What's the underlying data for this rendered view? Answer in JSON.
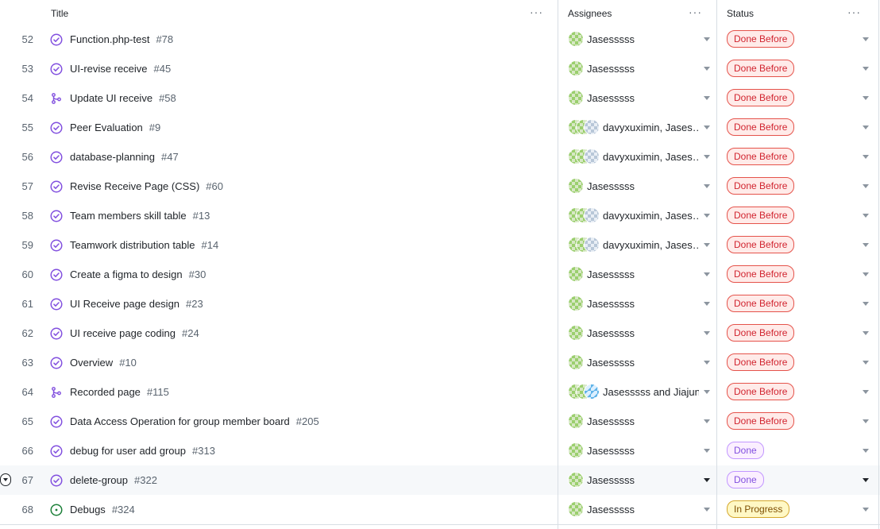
{
  "header": {
    "title": "Title",
    "assignees": "Assignees",
    "status": "Status",
    "menu": "···"
  },
  "colors": {
    "done_before": "#d1242f",
    "done": "#8250df",
    "in_progress": "#7d4e00",
    "closed_issue_icon": "#8250df",
    "open_issue_icon": "#1a7f37"
  },
  "rows": [
    {
      "num": "52",
      "title": "Function.php-test",
      "issue": "#78",
      "icon": "check-circle-icon",
      "avatars": [
        "a"
      ],
      "assignees": "Jasesssss",
      "status": "Done Before",
      "status_color": "red"
    },
    {
      "num": "53",
      "title": "UI-revise receive",
      "issue": "#45",
      "icon": "check-circle-icon",
      "avatars": [
        "a"
      ],
      "assignees": "Jasesssss",
      "status": "Done Before",
      "status_color": "red"
    },
    {
      "num": "54",
      "title": "Update UI receive",
      "issue": "#58",
      "icon": "pull-request-icon",
      "avatars": [
        "a"
      ],
      "assignees": "Jasesssss",
      "status": "Done Before",
      "status_color": "red"
    },
    {
      "num": "55",
      "title": "Peer Evaluation",
      "issue": "#9",
      "icon": "check-circle-icon",
      "avatars": [
        "a",
        "a",
        "b"
      ],
      "assignees": "davyxuximin, Jases…",
      "status": "Done Before",
      "status_color": "red"
    },
    {
      "num": "56",
      "title": "database-planning",
      "issue": "#47",
      "icon": "check-circle-icon",
      "avatars": [
        "a",
        "a",
        "b"
      ],
      "assignees": "davyxuximin, Jases…",
      "status": "Done Before",
      "status_color": "red"
    },
    {
      "num": "57",
      "title": "Revise Receive Page (CSS)",
      "issue": "#60",
      "icon": "check-circle-icon",
      "avatars": [
        "a"
      ],
      "assignees": "Jasesssss",
      "status": "Done Before",
      "status_color": "red"
    },
    {
      "num": "58",
      "title": "Team members skill table",
      "issue": "#13",
      "icon": "check-circle-icon",
      "avatars": [
        "a",
        "a",
        "b"
      ],
      "assignees": "davyxuximin, Jases…",
      "status": "Done Before",
      "status_color": "red"
    },
    {
      "num": "59",
      "title": "Teamwork distribution table",
      "issue": "#14",
      "icon": "check-circle-icon",
      "avatars": [
        "a",
        "a",
        "b"
      ],
      "assignees": "davyxuximin, Jases…",
      "status": "Done Before",
      "status_color": "red"
    },
    {
      "num": "60",
      "title": "Create a figma to design",
      "issue": "#30",
      "icon": "check-circle-icon",
      "avatars": [
        "a"
      ],
      "assignees": "Jasesssss",
      "status": "Done Before",
      "status_color": "red"
    },
    {
      "num": "61",
      "title": "UI Receive page design",
      "issue": "#23",
      "icon": "check-circle-icon",
      "avatars": [
        "a"
      ],
      "assignees": "Jasesssss",
      "status": "Done Before",
      "status_color": "red"
    },
    {
      "num": "62",
      "title": "UI receive page coding",
      "issue": "#24",
      "icon": "check-circle-icon",
      "avatars": [
        "a"
      ],
      "assignees": "Jasesssss",
      "status": "Done Before",
      "status_color": "red"
    },
    {
      "num": "63",
      "title": "Overview",
      "issue": "#10",
      "icon": "check-circle-icon",
      "avatars": [
        "a"
      ],
      "assignees": "Jasesssss",
      "status": "Done Before",
      "status_color": "red"
    },
    {
      "num": "64",
      "title": "Recorded page",
      "issue": "#115",
      "icon": "pull-request-icon",
      "avatars": [
        "a",
        "a",
        "c"
      ],
      "assignees": "Jasesssss and Jiajun…",
      "status": "Done Before",
      "status_color": "red"
    },
    {
      "num": "65",
      "title": "Data Access Operation for group member board",
      "issue": "#205",
      "icon": "check-circle-icon",
      "avatars": [
        "a"
      ],
      "assignees": "Jasesssss",
      "status": "Done Before",
      "status_color": "red"
    },
    {
      "num": "66",
      "title": "debug for user add group",
      "issue": "#313",
      "icon": "check-circle-icon",
      "avatars": [
        "a"
      ],
      "assignees": "Jasesssss",
      "status": "Done",
      "status_color": "purple"
    },
    {
      "num": "67",
      "title": "delete-group",
      "issue": "#322",
      "icon": "check-circle-icon",
      "avatars": [
        "a"
      ],
      "assignees": "Jasesssss",
      "status": "Done",
      "status_color": "purple",
      "selected": true
    },
    {
      "num": "68",
      "title": "Debugs",
      "issue": "#324",
      "icon": "open-issue-icon",
      "avatars": [
        "a"
      ],
      "assignees": "Jasesssss",
      "status": "In Progress",
      "status_color": "yellow"
    }
  ]
}
